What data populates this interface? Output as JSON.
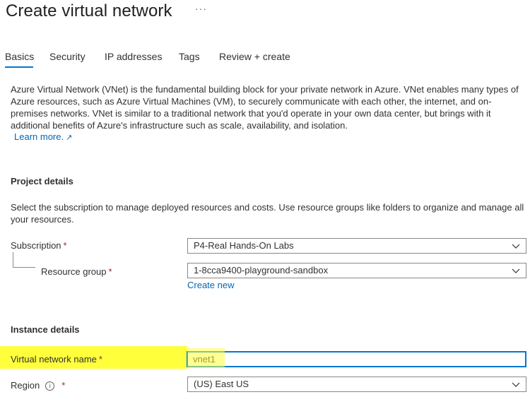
{
  "page": {
    "title": "Create virtual network",
    "more_label": "···"
  },
  "tabs": [
    {
      "label": "Basics",
      "active": true
    },
    {
      "label": "Security"
    },
    {
      "label": "IP addresses"
    },
    {
      "label": "Tags"
    },
    {
      "label": "Review + create"
    }
  ],
  "intro": {
    "text": "Azure Virtual Network (VNet) is the fundamental building block for your private network in Azure. VNet enables many types of Azure resources, such as Azure Virtual Machines (VM), to securely communicate with each other, the internet, and on-premises networks. VNet is similar to a traditional network that you'd operate in your own data center, but brings with it additional benefits of Azure's infrastructure such as scale, availability, and isolation.",
    "learn_more": "Learn more.",
    "learn_more_icon": "external-link-icon"
  },
  "project": {
    "title": "Project details",
    "description": "Select the subscription to manage deployed resources and costs. Use resource groups like folders to organize and manage all your resources.",
    "subscription_label": "Subscription",
    "subscription_value": "P4-Real Hands-On Labs",
    "resource_group_label": "Resource group",
    "resource_group_value": "1-8cca9400-playground-sandbox",
    "create_new": "Create new"
  },
  "instance": {
    "title": "Instance details",
    "vnet_name_label": "Virtual network name",
    "vnet_name_value": "vnet1",
    "region_label": "Region",
    "region_value": "(US) East US",
    "info_icon": "i"
  },
  "required_marker": "*",
  "colors": {
    "accent": "#0078d4",
    "link": "#0067b8",
    "highlight": "#ffff3c",
    "required": "#a4262c"
  }
}
